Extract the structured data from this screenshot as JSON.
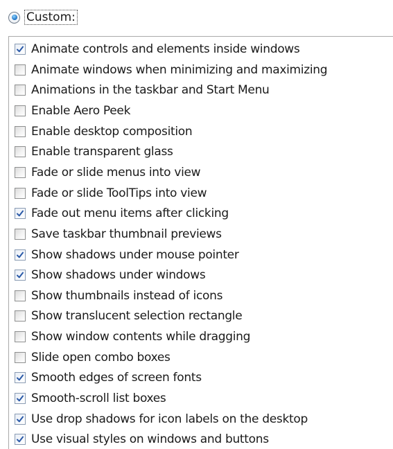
{
  "custom_option": {
    "label": "Custom:",
    "selected": true
  },
  "options": [
    {
      "label": "Animate controls and elements inside windows",
      "checked": true
    },
    {
      "label": "Animate windows when minimizing and maximizing",
      "checked": false
    },
    {
      "label": "Animations in the taskbar and Start Menu",
      "checked": false
    },
    {
      "label": "Enable Aero Peek",
      "checked": false
    },
    {
      "label": "Enable desktop composition",
      "checked": false
    },
    {
      "label": "Enable transparent glass",
      "checked": false
    },
    {
      "label": "Fade or slide menus into view",
      "checked": false
    },
    {
      "label": "Fade or slide ToolTips into view",
      "checked": false
    },
    {
      "label": "Fade out menu items after clicking",
      "checked": true
    },
    {
      "label": "Save taskbar thumbnail previews",
      "checked": false
    },
    {
      "label": "Show shadows under mouse pointer",
      "checked": true
    },
    {
      "label": "Show shadows under windows",
      "checked": true
    },
    {
      "label": "Show thumbnails instead of icons",
      "checked": false
    },
    {
      "label": "Show translucent selection rectangle",
      "checked": false
    },
    {
      "label": "Show window contents while dragging",
      "checked": false
    },
    {
      "label": "Slide open combo boxes",
      "checked": false
    },
    {
      "label": "Smooth edges of screen fonts",
      "checked": true
    },
    {
      "label": "Smooth-scroll list boxes",
      "checked": true
    },
    {
      "label": "Use drop shadows for icon labels on the desktop",
      "checked": true
    },
    {
      "label": "Use visual styles on windows and buttons",
      "checked": true
    }
  ],
  "colors": {
    "checkmark": "#2b5aa8",
    "radio_dot": "#1b6fc2"
  }
}
